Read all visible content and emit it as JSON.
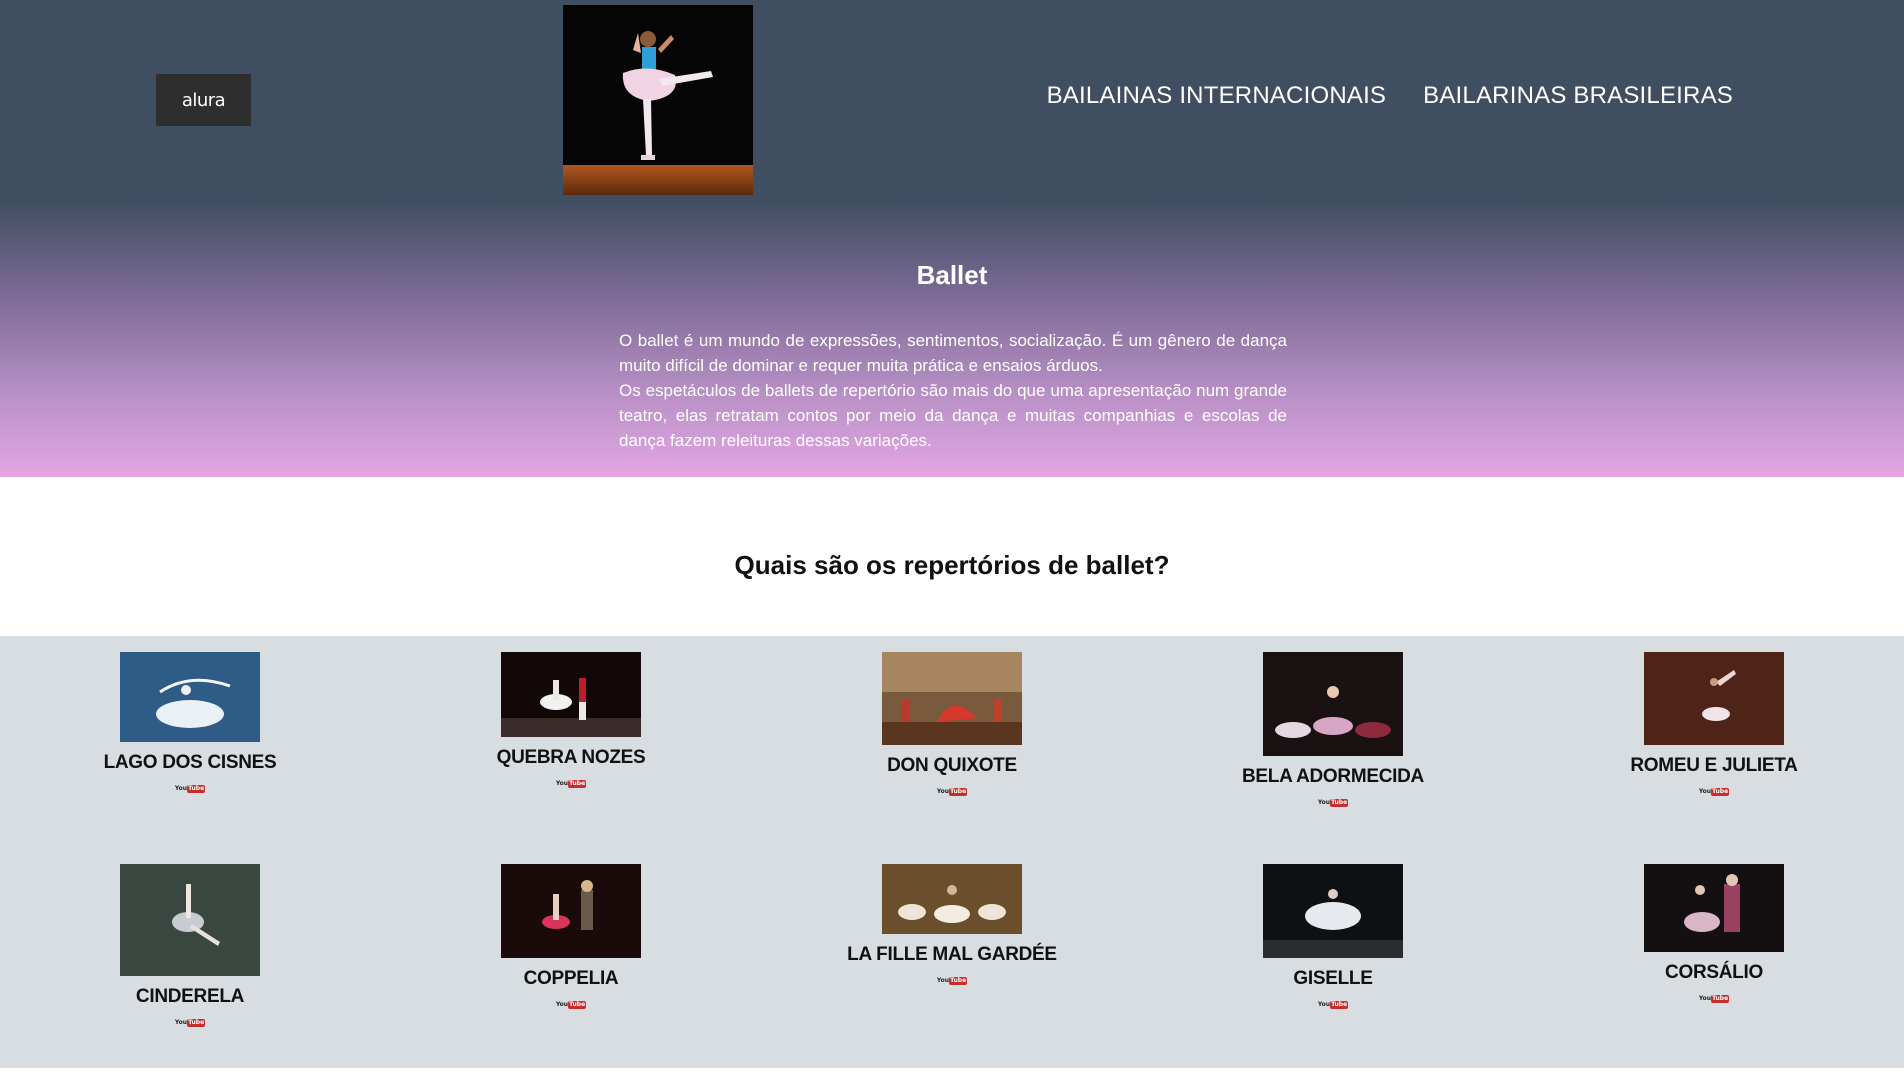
{
  "header": {
    "logo_text": "alura",
    "nav": [
      {
        "label": "BAILAINAS INTERNACIONAIS"
      },
      {
        "label": "BAILARINAS BRASILEIRAS"
      }
    ]
  },
  "intro": {
    "title": "Ballet",
    "paragraph1": "O ballet é um mundo de expressões, sentimentos, socialização. É um gênero de dança muito difícil de dominar e requer muita prática e ensaios árduos.",
    "paragraph2": "Os espetáculos de ballets de repertório são mais do que uma apresentação num grande teatro, elas retratam contos por meio da dança e muitas companhias e escolas de dança fazem releituras dessas variações."
  },
  "repertoire": {
    "title": "Quais são os repertórios de ballet?",
    "items": [
      {
        "name": "LAGO DOS CISNES"
      },
      {
        "name": "QUEBRA NOZES"
      },
      {
        "name": "DON QUIXOTE"
      },
      {
        "name": "BELA ADORMECIDA"
      },
      {
        "name": "ROMEU E JULIETA"
      },
      {
        "name": "CINDERELA"
      },
      {
        "name": "COPPELIA"
      },
      {
        "name": "LA FILLE MAL GARDÉE"
      },
      {
        "name": "GISELLE"
      },
      {
        "name": "CORSÁLIO"
      }
    ],
    "youtube_label": {
      "you": "You",
      "tube": "Tube"
    }
  },
  "colors": {
    "header_bg": "#404e61",
    "gradient_end": "#e3a6e3",
    "grid_bg": "#d7dde0",
    "youtube_red": "#c4302b"
  }
}
